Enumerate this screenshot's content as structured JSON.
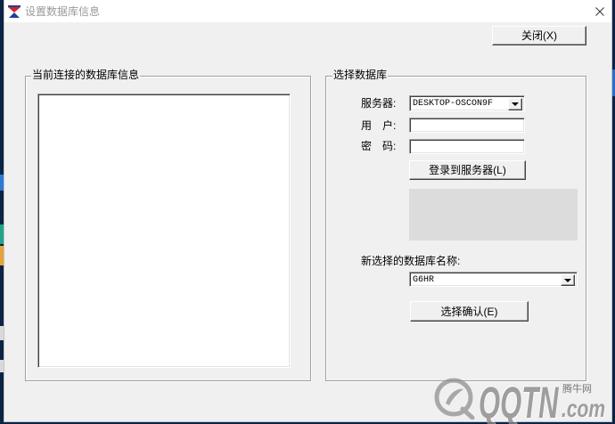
{
  "window": {
    "title": "设置数据库信息"
  },
  "toolbar": {
    "close_label": "关闭(X)"
  },
  "current_connection": {
    "group_label": "当前连接的数据库信息"
  },
  "select_database": {
    "group_label": "选择数据库",
    "server_label": "服务器:",
    "server_value": "DESKTOP-OSCON9F",
    "user_label": "用　户:",
    "user_value": "",
    "password_label": "密　码:",
    "password_value": "",
    "login_button": "登录到服务器(L)",
    "new_db_label": "新选择的数据库名称:",
    "new_db_value": "G6HR",
    "confirm_button": "选择确认(E)"
  },
  "watermark": {
    "site_name": "腾牛网",
    "brand": "QQTN",
    "suffix": ".com"
  },
  "icons": {
    "app": "app-logo-icon",
    "window_close": "close-icon",
    "dropdown": "chevron-down-icon",
    "watermark_logo": "watermark-logo-icon"
  },
  "colors": {
    "window_bg": "#f0f0f0",
    "titlebar_bg": "#ffffff",
    "title_text": "#999999",
    "disabled_panel": "#dcdcdc"
  }
}
